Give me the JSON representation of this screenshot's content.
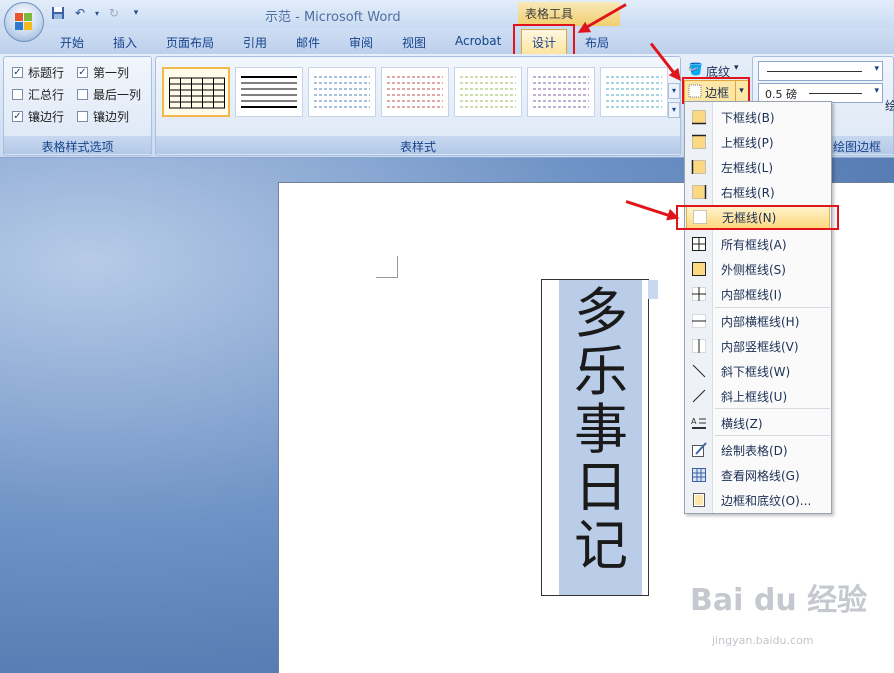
{
  "window": {
    "title": "示范 - Microsoft Word",
    "context_tab_group": "表格工具"
  },
  "tabs": [
    {
      "label": "开始"
    },
    {
      "label": "插入"
    },
    {
      "label": "页面布局"
    },
    {
      "label": "引用"
    },
    {
      "label": "邮件"
    },
    {
      "label": "审阅"
    },
    {
      "label": "视图"
    },
    {
      "label": "Acrobat"
    },
    {
      "label": "设计",
      "active": true
    },
    {
      "label": "布局"
    }
  ],
  "ribbon": {
    "table_style_options": {
      "group_label": "表格样式选项",
      "options": [
        {
          "label": "标题行",
          "checked": true
        },
        {
          "label": "第一列",
          "checked": true
        },
        {
          "label": "汇总行",
          "checked": false
        },
        {
          "label": "最后一列",
          "checked": false
        },
        {
          "label": "镶边行",
          "checked": true
        },
        {
          "label": "镶边列",
          "checked": false
        }
      ]
    },
    "table_styles": {
      "group_label": "表样式",
      "tile_colors": [
        "#000000",
        "#000000",
        "#4f81bd",
        "#c0504d",
        "#9bbb59",
        "#8064a2",
        "#4bacc6"
      ]
    },
    "shading_label": "底纹",
    "border_label": "边框",
    "pen_weight": "0.5 磅",
    "draw_borders_label": "绘图边框",
    "draw_borders_cut": "绘"
  },
  "document": {
    "cell_text": "多乐事日记"
  },
  "border_menu": {
    "items": [
      {
        "label": "下框线(B)",
        "icon": "bottom-border-icon"
      },
      {
        "label": "上框线(P)",
        "icon": "top-border-icon"
      },
      {
        "label": "左框线(L)",
        "icon": "left-border-icon"
      },
      {
        "label": "右框线(R)",
        "icon": "right-border-icon"
      },
      {
        "label": "无框线(N)",
        "icon": "no-border-icon",
        "highlighted": true
      },
      {
        "label": "所有框线(A)",
        "icon": "all-borders-icon"
      },
      {
        "label": "外侧框线(S)",
        "icon": "outside-borders-icon"
      },
      {
        "label": "内部框线(I)",
        "icon": "inside-borders-icon"
      },
      {
        "label": "内部横框线(H)",
        "icon": "inside-horizontal-border-icon"
      },
      {
        "label": "内部竖框线(V)",
        "icon": "inside-vertical-border-icon"
      },
      {
        "label": "斜下框线(W)",
        "icon": "diagonal-down-border-icon"
      },
      {
        "label": "斜上框线(U)",
        "icon": "diagonal-up-border-icon"
      },
      {
        "label": "横线(Z)",
        "icon": "horizontal-line-icon"
      },
      {
        "label": "绘制表格(D)",
        "icon": "draw-table-icon"
      },
      {
        "label": "查看网格线(G)",
        "icon": "view-gridlines-icon"
      },
      {
        "label": "边框和底纹(O)...",
        "icon": "borders-shading-icon"
      }
    ]
  },
  "watermark": {
    "brand": "Bai du 经验",
    "url": "jingyan.baidu.com"
  }
}
